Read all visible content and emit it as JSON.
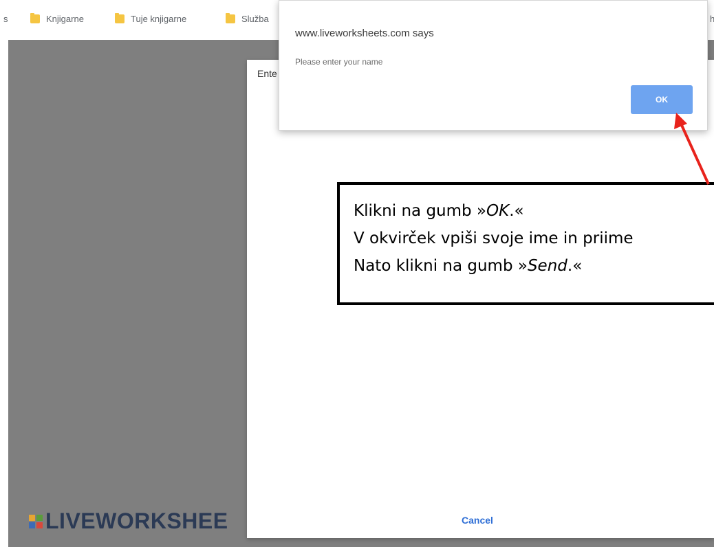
{
  "bookmarks": {
    "leading": "s",
    "items": [
      "Knjigarne",
      "Tuje knjigarne",
      "Služba"
    ],
    "trailing": "h"
  },
  "background_page": {
    "logo_text": "LIVEWORKSHEE"
  },
  "prompt_dialog": {
    "title": "Ente",
    "cancel_label": "Cancel"
  },
  "alert": {
    "title": "www.liveworksheets.com says",
    "message": "Please enter your name",
    "ok_label": "OK"
  },
  "callout": {
    "line1_prefix": "Klikni na gumb »",
    "line1_em": "OK",
    "line1_suffix": ".«",
    "line2": "V okvirček vpiši svoje ime in priime",
    "line3_prefix": "Nato klikni na gumb »",
    "line3_em": "Send",
    "line3_suffix": ".«"
  },
  "colors": {
    "overlay": "#7f7f7f",
    "ok_button": "#6ea4f0",
    "cancel_link": "#2f6fd6",
    "arrow": "#e8231c",
    "folder": "#f5c542"
  }
}
